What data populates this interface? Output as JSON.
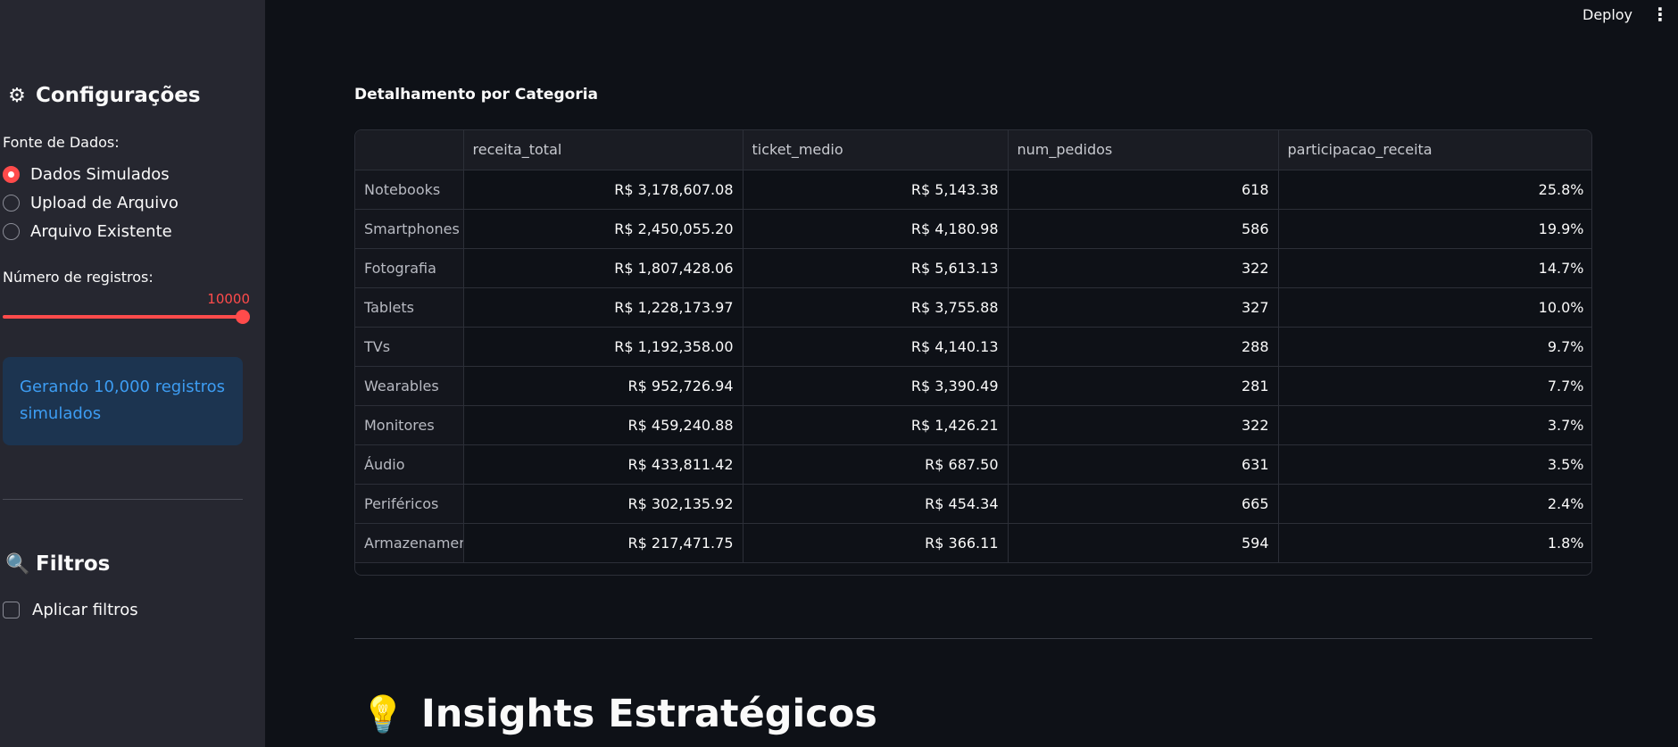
{
  "header": {
    "deploy_label": "Deploy",
    "menu_icon": "⋮"
  },
  "sidebar": {
    "config_title": "Configurações",
    "config_icon": "gear-icon",
    "data_source_label": "Fonte de Dados:",
    "radio_options": [
      {
        "label": "Dados Simulados",
        "checked": true
      },
      {
        "label": "Upload de Arquivo",
        "checked": false
      },
      {
        "label": "Arquivo Existente",
        "checked": false
      }
    ],
    "records_label": "Número de registros:",
    "records_value": "10000",
    "info_message": "Gerando 10,000 registros simulados",
    "filters_title": "Filtros",
    "filters_icon": "magnifier-icon",
    "apply_filters_label": "Aplicar filtros",
    "apply_filters_checked": false
  },
  "main": {
    "section_title": "Detalhamento por Categoria",
    "table": {
      "columns": [
        "",
        "receita_total",
        "ticket_medio",
        "num_pedidos",
        "participacao_receita"
      ],
      "rows": [
        [
          "Notebooks",
          "R$ 3,178,607.08",
          "R$ 5,143.38",
          "618",
          "25.8%"
        ],
        [
          "Smartphones",
          "R$ 2,450,055.20",
          "R$ 4,180.98",
          "586",
          "19.9%"
        ],
        [
          "Fotografia",
          "R$ 1,807,428.06",
          "R$ 5,613.13",
          "322",
          "14.7%"
        ],
        [
          "Tablets",
          "R$ 1,228,173.97",
          "R$ 3,755.88",
          "327",
          "10.0%"
        ],
        [
          "TVs",
          "R$ 1,192,358.00",
          "R$ 4,140.13",
          "288",
          "9.7%"
        ],
        [
          "Wearables",
          "R$ 952,726.94",
          "R$ 3,390.49",
          "281",
          "7.7%"
        ],
        [
          "Monitores",
          "R$ 459,240.88",
          "R$ 1,426.21",
          "322",
          "3.7%"
        ],
        [
          "Áudio",
          "R$ 433,811.42",
          "R$ 687.50",
          "631",
          "3.5%"
        ],
        [
          "Periféricos",
          "R$ 302,135.92",
          "R$ 454.34",
          "665",
          "2.4%"
        ],
        [
          "Armazenamento",
          "R$ 217,471.75",
          "R$ 366.11",
          "594",
          "1.8%"
        ]
      ]
    },
    "insights_title": "Insights Estratégicos",
    "insights_icon": "lightbulb-icon"
  },
  "colors": {
    "accent": "#ff4b4b",
    "sidebar_bg": "#262730",
    "main_bg": "#0e1117",
    "info_bg": "#1c3450",
    "info_text": "#3d9df3"
  }
}
